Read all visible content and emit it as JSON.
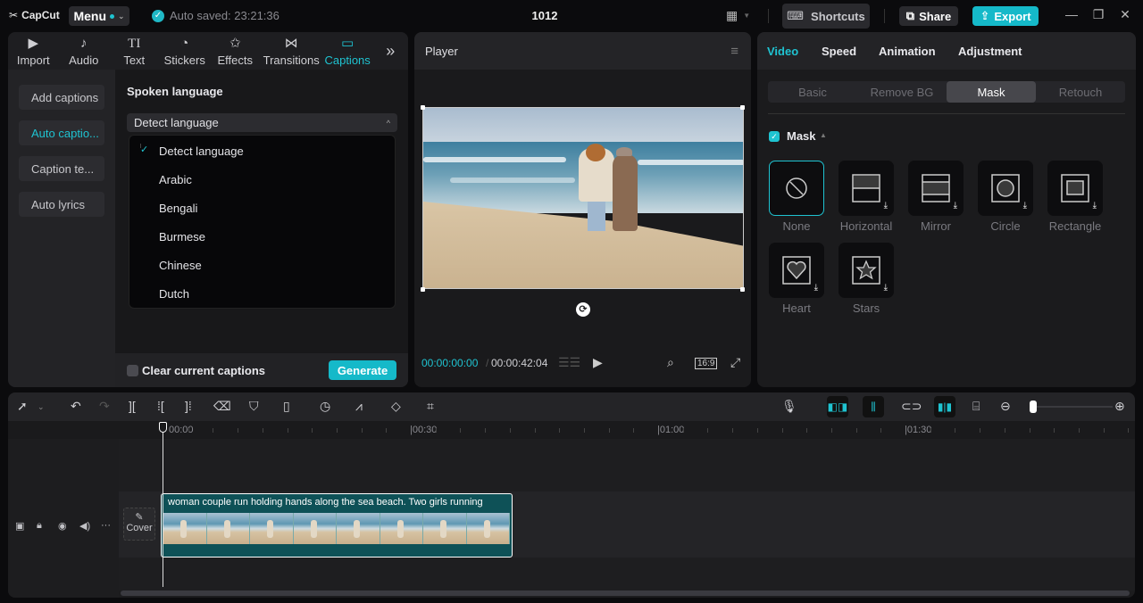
{
  "app": {
    "logo": "CapCut",
    "menu_label": "Menu",
    "autosave": "Auto saved: 23:21:36",
    "project_title": "1012",
    "shortcuts_label": "Shortcuts",
    "share_label": "Share",
    "export_label": "Export",
    "accent": "#1fc3d1"
  },
  "media_tabs": [
    {
      "label": "Import",
      "icon": "import-icon"
    },
    {
      "label": "Audio",
      "icon": "audio-icon"
    },
    {
      "label": "Text",
      "icon": "text-icon"
    },
    {
      "label": "Stickers",
      "icon": "stickers-icon"
    },
    {
      "label": "Effects",
      "icon": "effects-icon"
    },
    {
      "label": "Transitions",
      "icon": "transitions-icon"
    },
    {
      "label": "Captions",
      "icon": "captions-icon",
      "active": true
    }
  ],
  "captions_sidebar": [
    {
      "label": "Add captions"
    },
    {
      "label": "Auto captio...",
      "active": true
    },
    {
      "label": "Caption te..."
    },
    {
      "label": "Auto lyrics"
    }
  ],
  "captions": {
    "spoken_language_label": "Spoken language",
    "selected_language": "Detect language",
    "options": [
      "Detect language",
      "Arabic",
      "Bengali",
      "Burmese",
      "Chinese",
      "Dutch"
    ],
    "clear_label": "Clear current captions",
    "clear_checked": false,
    "generate_label": "Generate"
  },
  "player": {
    "title": "Player",
    "current_time": "00:00:00:00",
    "separator": "/",
    "total_time": "00:00:42:04",
    "ratio": "16:9"
  },
  "inspector": {
    "tabs": [
      {
        "label": "Video",
        "active": true
      },
      {
        "label": "Speed"
      },
      {
        "label": "Animation"
      },
      {
        "label": "Adjustment"
      }
    ],
    "subtabs": [
      {
        "label": "Basic"
      },
      {
        "label": "Remove BG"
      },
      {
        "label": "Mask",
        "active": true
      },
      {
        "label": "Retouch"
      }
    ],
    "mask_label": "Mask",
    "mask_enabled": true,
    "masks": [
      {
        "label": "None",
        "selected": true
      },
      {
        "label": "Horizontal"
      },
      {
        "label": "Mirror"
      },
      {
        "label": "Circle"
      },
      {
        "label": "Rectangle"
      },
      {
        "label": "Heart"
      },
      {
        "label": "Stars"
      }
    ]
  },
  "timeline": {
    "ruler_labels": [
      "00:00",
      "00:30",
      "01:00",
      "01:30"
    ],
    "clip_text": "woman couple run holding hands along the sea beach. Two girls running",
    "cover_label": "Cover",
    "zoom_level": 0.05
  }
}
